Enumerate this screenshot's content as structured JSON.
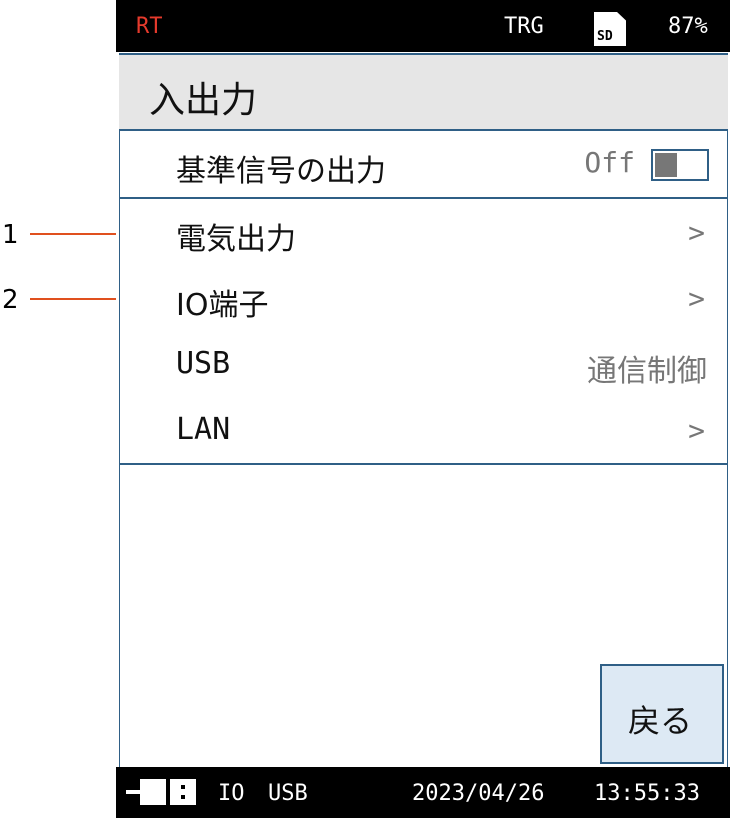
{
  "callouts": [
    "1",
    "2"
  ],
  "status": {
    "mode": "RT",
    "trigger": "TRG",
    "sd_label": "SD",
    "battery": "87%"
  },
  "title": "入出力",
  "menu": [
    {
      "label": "基準信号の出力",
      "value": "Off",
      "type": "toggle",
      "toggle_on": false
    },
    {
      "label": "電気出力",
      "value": ">",
      "type": "submenu"
    },
    {
      "label": "IO端子",
      "value": ">",
      "type": "submenu"
    },
    {
      "label": "USB",
      "value": "通信制御",
      "type": "value"
    },
    {
      "label": "LAN",
      "value": ">",
      "type": "submenu"
    }
  ],
  "back_label": "戻る",
  "footer": {
    "io": "IO",
    "usb": "USB",
    "date": "2023/04/26",
    "time": "13:55:33"
  },
  "colors": {
    "accent_border": "#2f5f86",
    "callout_line": "#e0501e",
    "rt_red": "#e53a2c",
    "back_button_bg": "#dde9f4"
  }
}
